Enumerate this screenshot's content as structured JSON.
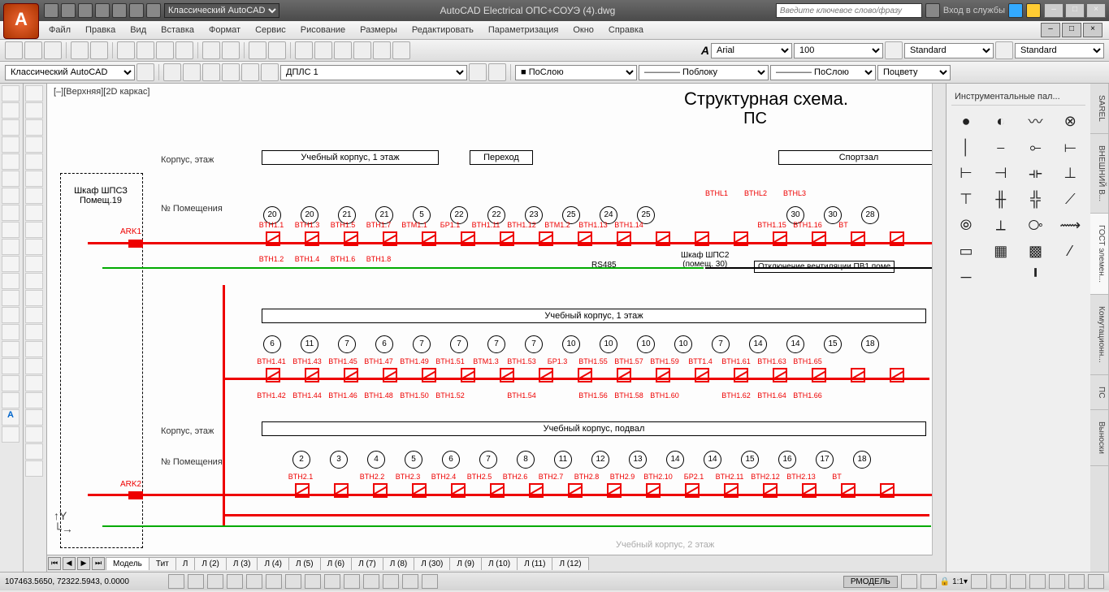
{
  "app": {
    "title": "AutoCAD Electrical   ОПС+СОУЭ (4).dwg",
    "search_ph": "Введите ключевое слово/фразу",
    "signin": "Вход в службы"
  },
  "workspace_sel": "Классический AutoCAD",
  "menus": [
    "Файл",
    "Правка",
    "Вид",
    "Вставка",
    "Формат",
    "Сервис",
    "Рисование",
    "Размеры",
    "Редактировать",
    "Параметризация",
    "Окно",
    "Справка"
  ],
  "props": {
    "font": "Arial",
    "height": "100",
    "ts": "Standard",
    "ds": "Standard",
    "ws": "Классический AutoCAD",
    "layer": "ДПЛС 1",
    "color": "ПоСлою",
    "ltype": "———— Поблоку",
    "lw": "———— ПоСлою",
    "plot": "Поцвету"
  },
  "viewport": "[–][Верхняя][2D каркас]",
  "drawing": {
    "title": "Структурная схема.",
    "sub": "ПС",
    "lab_floor": "Корпус, этаж",
    "lab_room": "№ Помещения",
    "cabinet1": "Шкаф ШПСЗ",
    "cabinet1_room": "Помещ.19",
    "floor1a": "Учебный корпус, 1 этаж",
    "floor1b": "Переход",
    "floor1c": "Спортзал",
    "rooms1": [
      "20",
      "20",
      "21",
      "21",
      "5",
      "22",
      "22",
      "23",
      "25",
      "24",
      "25",
      "",
      "",
      "",
      "30",
      "30",
      "28"
    ],
    "dev1": [
      "BTH1.1",
      "BTH1.3",
      "BTH1.5",
      "BTH1.7",
      "BTM1.1",
      "БР1.1",
      "BTH1.11",
      "BTH1.12",
      "BTM1.2",
      "BTH1.13",
      "BTH1.14",
      "",
      "",
      "",
      "BTH1.15",
      "BTH1.16",
      "BT"
    ],
    "dev1b": [
      "BTH1.2",
      "BTH1.4",
      "BTH1.6",
      "BTH1.8"
    ],
    "bthl": [
      "BTHL1",
      "BTHL2",
      "BTHL3"
    ],
    "cab2": "Шкаф ШПС2",
    "cab2r": "(помещ. 30)",
    "rs": "RS485",
    "vent": "Отключение вентиляции ПВ1 поме",
    "ark1": "ARK1",
    "ark2": "ARK2",
    "floor2": "Учебный корпус, 1 этаж",
    "rooms2": [
      "6",
      "11",
      "7",
      "6",
      "7",
      "7",
      "7",
      "7",
      "10",
      "10",
      "10",
      "10",
      "7",
      "14",
      "14",
      "15",
      "18"
    ],
    "dev2": [
      "BTH1.41",
      "BTH1.43",
      "BTH1.45",
      "BTH1.47",
      "BTH1.49",
      "BTH1.51",
      "BTM1.3",
      "BTH1.53",
      "БР1.3",
      "BTH1.55",
      "BTH1.57",
      "BTH1.59",
      "BTT1.4",
      "BTH1.61",
      "BTH1.63",
      "BTH1.65",
      ""
    ],
    "dev2b": [
      "BTH1.42",
      "BTH1.44",
      "BTH1.46",
      "BTH1.48",
      "BTH1.50",
      "BTH1.52",
      "",
      "BTH1.54",
      "",
      "BTH1.56",
      "BTH1.58",
      "BTH1.60",
      "",
      "BTH1.62",
      "BTH1.64",
      "BTH1.66",
      ""
    ],
    "floor3": "Учебный корпус, подвал",
    "rooms3": [
      "2",
      "3",
      "4",
      "5",
      "6",
      "7",
      "8",
      "11",
      "12",
      "13",
      "14",
      "14",
      "15",
      "16",
      "17",
      "18"
    ],
    "dev3": [
      "BTH2.1",
      "",
      "BTH2.2",
      "BTH2.3",
      "BTH2.4",
      "BTH2.5",
      "BTH2.6",
      "BTH2.7",
      "BTH2.8",
      "BTH2.9",
      "BTH2.10",
      "БР2.1",
      "BTH2.11",
      "BTH2.12",
      "BTH2.13",
      "BT"
    ],
    "floor4": "Учебный корпус, 2 этаж"
  },
  "tabs": [
    "Модель",
    "Тит",
    "Л",
    "Л (2)",
    "Л (3)",
    "Л (4)",
    "Л (5)",
    "Л (6)",
    "Л (7)",
    "Л (8)",
    "Л (30)",
    "Л (9)",
    "Л (10)",
    "Л (11)",
    "Л (12)"
  ],
  "palette": {
    "title": "Инструментальные пал...",
    "tabs": [
      "SAREL",
      "ВНЕШНИЙ В...",
      "ГОСТ элемен...",
      "Комутационн...",
      "ПС",
      "Выноски"
    ]
  },
  "status": {
    "coords": "107463.5650, 72322.5943, 0.0000",
    "space": "РМОДЕЛЬ",
    "scale": "1:1"
  }
}
